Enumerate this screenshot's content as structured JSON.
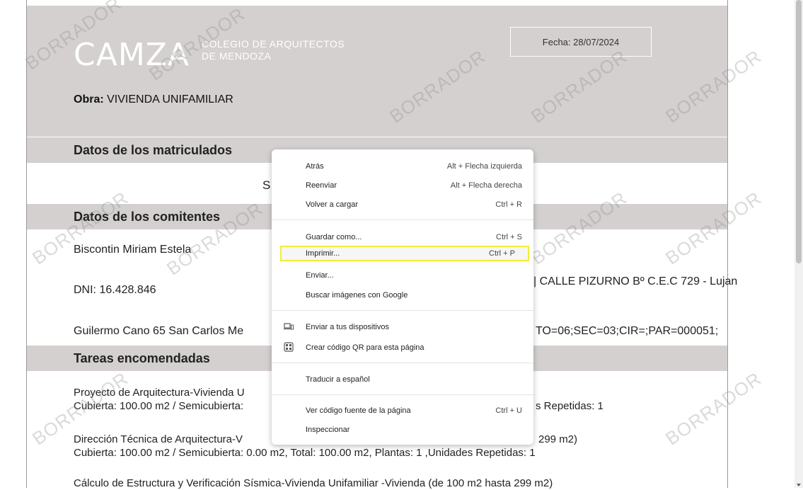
{
  "header": {
    "logo": "CAMZA",
    "org_line1": "COLEGIO DE ARQUITECTOS",
    "org_line2": "DE MENDOZA",
    "fecha": "Fecha: 28/07/2024",
    "obra_label": "Obra:",
    "obra_value": "VIVIENDA UNIFAMILIAR"
  },
  "sections": {
    "matriculados": "Datos de los matriculados",
    "matriculados_partial": "S",
    "comitentes": "Datos de los comitentes",
    "tareas": "Tareas encomendadas"
  },
  "comitente": {
    "name": "Biscontin Miriam Estela",
    "dni": "DNI: 16.428.846",
    "address": "Guilermo Cano 65 San Carlos Me",
    "location_right": "| CALLE PIZURNO Bº C.E.C 729 - Lujan",
    "cadastral_right": "TO=06;SEC=03;CIR=;PAR=000051;"
  },
  "tareas": [
    {
      "line1": "Proyecto de Arquitectura-Vivienda U",
      "line2": "Cubierta: 100.00 m2 / Semicubierta:",
      "line2_right": "s Repetidas: 1"
    },
    {
      "line1": "Dirección Técnica de Arquitectura-V",
      "line1_right": "299 m2)",
      "line2": "Cubierta: 100.00 m2 / Semicubierta: 0.00 m2, Total: 100.00 m2, Plantas: 1 ,Unidades Repetidas: 1"
    },
    {
      "line1": "Cálculo de Estructura y Verificación Sísmica-Vivienda Unifamiliar -Vivienda (de 100 m2 hasta 299 m2)"
    }
  ],
  "watermark": "BORRADOR",
  "context_menu": {
    "items": [
      {
        "label": "Atrás",
        "shortcut": "Alt + Flecha izquierda"
      },
      {
        "label": "Reenviar",
        "shortcut": "Alt + Flecha derecha"
      },
      {
        "label": "Volver a cargar",
        "shortcut": "Ctrl + R"
      },
      {
        "label": "Guardar como...",
        "shortcut": "Ctrl + S"
      },
      {
        "label": "Imprimir...",
        "shortcut": "Ctrl + P"
      },
      {
        "label": "Enviar..."
      },
      {
        "label": "Buscar imágenes con Google"
      },
      {
        "label": "Enviar a tus dispositivos",
        "icon": "devices-icon"
      },
      {
        "label": "Crear código QR para esta página",
        "icon": "qr-code-icon"
      },
      {
        "label": "Traducir a español"
      },
      {
        "label": "Ver código fuente de la página",
        "shortcut": "Ctrl + U"
      },
      {
        "label": "Inspeccionar"
      }
    ],
    "highlight_color": "#f2ec3a"
  }
}
